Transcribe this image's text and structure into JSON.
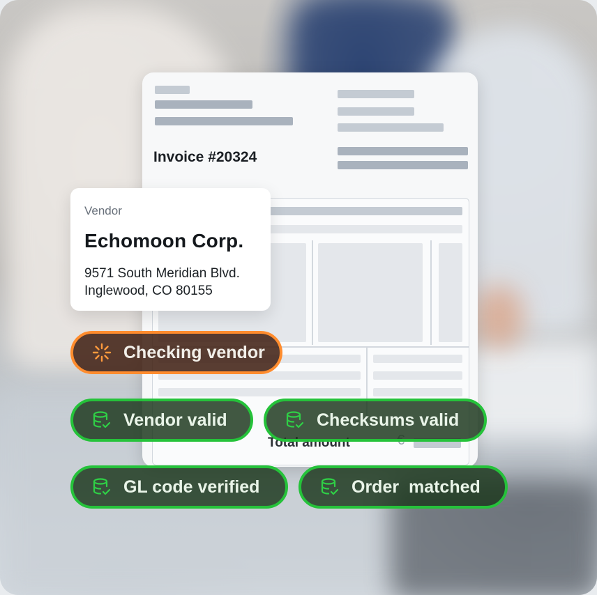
{
  "invoice": {
    "title": "Invoice #20324",
    "total_label": "Total amount",
    "currency_symbol": "€"
  },
  "vendor_card": {
    "label": "Vendor",
    "name": "Echomoon Corp.",
    "address_line1": "9571 South Meridian Blvd.",
    "address_line2": "Inglewood, CO 80155"
  },
  "status": {
    "checking": {
      "label": "Checking vendor",
      "icon": "spinner-icon",
      "color": "#ff8c2e"
    },
    "checks": [
      {
        "label": "Vendor valid",
        "icon": "database-check-icon"
      },
      {
        "label": "Checksums valid",
        "icon": "database-check-icon"
      },
      {
        "label": "GL code verified",
        "icon": "database-check-icon"
      },
      {
        "label": "Order  matched",
        "icon": "database-check-icon"
      }
    ],
    "check_color": "#25c23a"
  }
}
